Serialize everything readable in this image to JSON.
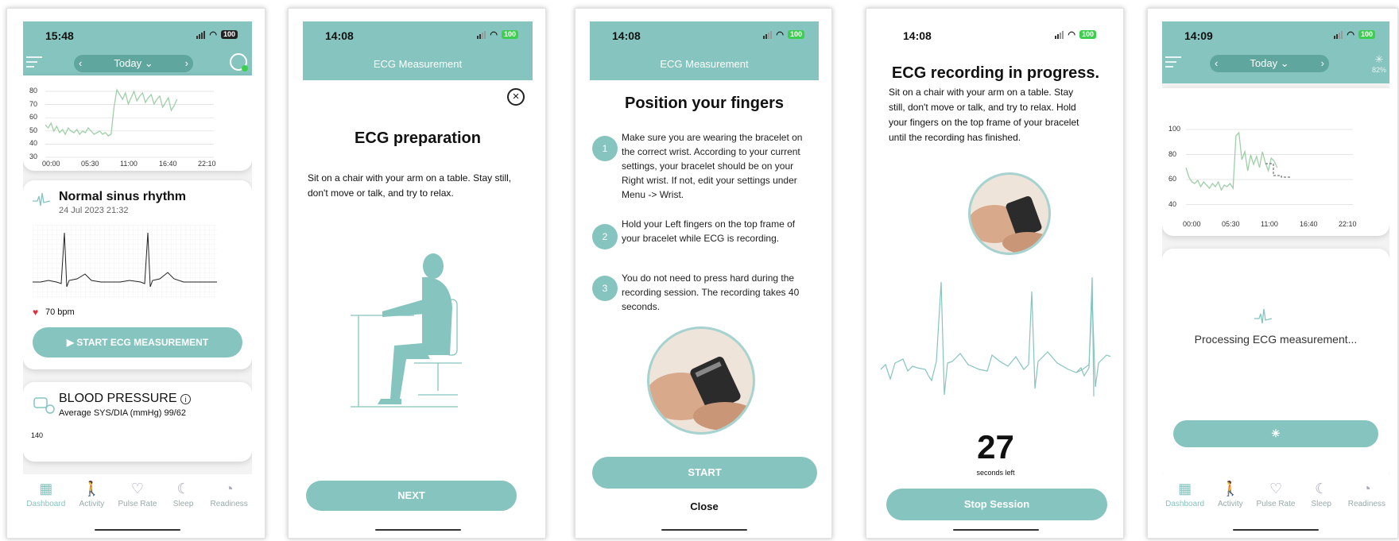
{
  "colors": {
    "teal": "#86c4bf",
    "teal_dark": "#6fb2ac",
    "heart": "#e0303a",
    "battery": "#3ccf4e"
  },
  "screen1": {
    "time": "15:48",
    "battery": "100",
    "date_nav": "Today",
    "chart_y_ticks": [
      "80",
      "70",
      "60",
      "50",
      "40",
      "30"
    ],
    "chart_x_ticks": [
      "00:00",
      "05:30",
      "11:00",
      "16:40",
      "22:10"
    ],
    "ecg_title": "Normal sinus rhythm",
    "ecg_date": "24 Jul 2023 21:32",
    "bpm": "70 bpm",
    "start_button": "START ECG MEASUREMENT",
    "bp_title": "BLOOD PRESSURE",
    "bp_avg": "Average SYS/DIA (mmHg) 99/62",
    "bp_tick": "140",
    "tabs": [
      "Dashboard",
      "Activity",
      "Pulse Rate",
      "Sleep",
      "Readiness"
    ]
  },
  "screen2": {
    "time": "14:08",
    "battery": "100",
    "header": "ECG Measurement",
    "title": "ECG preparation",
    "body": "Sit on a chair with your arm on a table. Stay still, don't move or talk, and try to relax.",
    "next_button": "NEXT"
  },
  "screen3": {
    "time": "14:08",
    "battery": "100",
    "header": "ECG Measurement",
    "title": "Position your fingers",
    "steps": [
      {
        "num": "1",
        "text": "Make sure you are wearing the bracelet on the correct wrist. According to your current settings, your bracelet should be on your Right wrist. If not, edit your settings under Menu -> Wrist."
      },
      {
        "num": "2",
        "text": "Hold your Left fingers on the top frame of your bracelet while ECG is recording."
      },
      {
        "num": "3",
        "text": "You do not need to press hard during the recording session. The recording takes 40 seconds."
      }
    ],
    "start_button": "START",
    "close_link": "Close"
  },
  "screen4": {
    "time": "14:08",
    "battery": "100",
    "title": "ECG recording in progress.",
    "body": "Sit on a chair with your arm on a table. Stay still, don't move or talk, and try to relax. Hold your fingers on the top frame of your bracelet until the recording has finished.",
    "countdown": "27",
    "countdown_label": "seconds left",
    "stop_button": "Stop Session"
  },
  "screen5": {
    "time": "14:09",
    "battery": "100",
    "date_nav": "Today",
    "sync_percent": "82%",
    "chart_y_ticks": [
      "100",
      "80",
      "60",
      "40"
    ],
    "chart_x_ticks": [
      "00:00",
      "05:30",
      "11:00",
      "16:40",
      "22:10"
    ],
    "processing": "Processing ECG measurement...",
    "tabs": [
      "Dashboard",
      "Activity",
      "Pulse Rate",
      "Sleep",
      "Readiness"
    ]
  }
}
